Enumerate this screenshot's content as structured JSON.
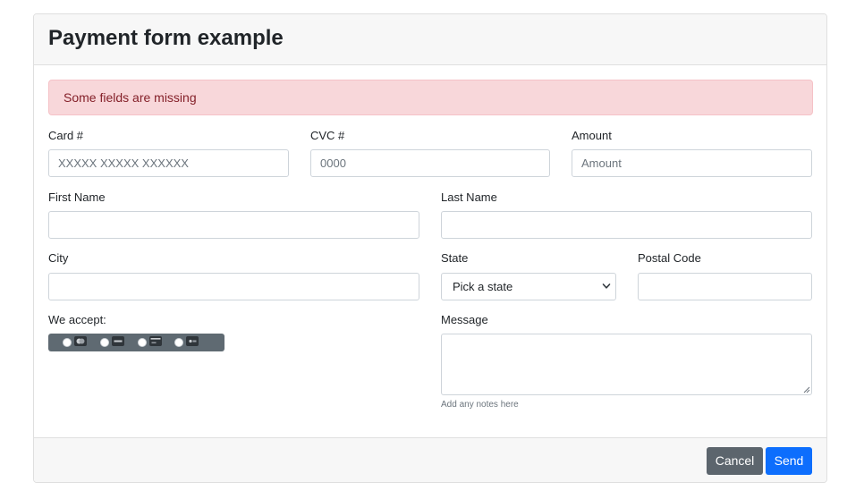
{
  "header": {
    "title": "Payment form example"
  },
  "alert": {
    "text": "Some fields are missing"
  },
  "fields": {
    "card_number": {
      "label": "Card #",
      "placeholder": "XXXXX XXXXX XXXXXX",
      "value": ""
    },
    "cvc": {
      "label": "CVC #",
      "placeholder": "0000",
      "value": ""
    },
    "amount": {
      "label": "Amount",
      "placeholder": "Amount",
      "value": ""
    },
    "first_name": {
      "label": "First Name",
      "value": ""
    },
    "last_name": {
      "label": "Last Name",
      "value": ""
    },
    "city": {
      "label": "City",
      "value": ""
    },
    "state": {
      "label": "State",
      "selected": "Pick a state"
    },
    "postal_code": {
      "label": "Postal Code",
      "value": ""
    },
    "message": {
      "label": "Message",
      "help": "Add any notes here"
    }
  },
  "payment_methods": {
    "label": "We accept:",
    "options": [
      {
        "icon": "mastercard-icon",
        "selected": false
      },
      {
        "icon": "visa-icon",
        "selected": false
      },
      {
        "icon": "credit-card-icon",
        "selected": false
      },
      {
        "icon": "apple-pay-icon",
        "selected": false
      }
    ]
  },
  "footer": {
    "cancel_label": "Cancel",
    "send_label": "Send"
  },
  "colors": {
    "alert_bg": "#f8d7da",
    "alert_text": "#842029",
    "primary": "#0d6efd",
    "secondary": "#5c656d"
  }
}
